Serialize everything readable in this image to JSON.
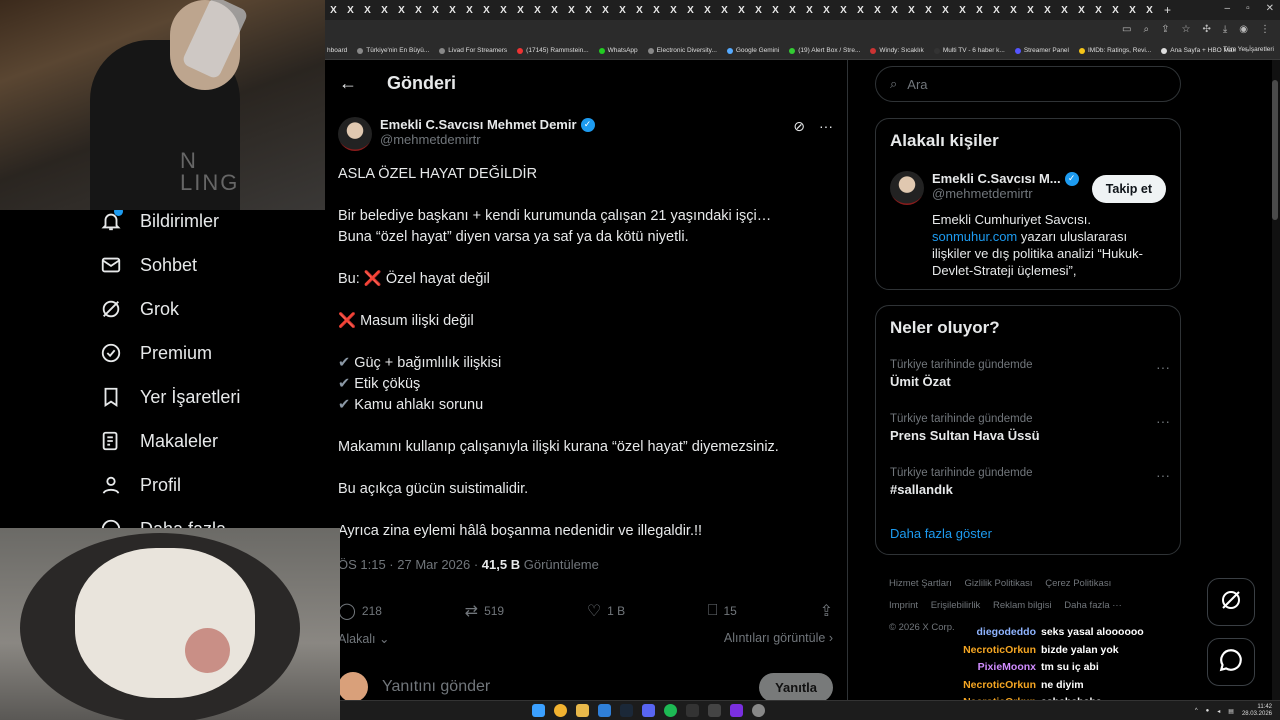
{
  "browser": {
    "tab_glyph": "X",
    "tab_count": 49,
    "new_tab": "+",
    "window_controls": [
      "–",
      "▫",
      "✕"
    ],
    "bookmarks": [
      "hboard",
      "Türkiye'nin En Büyü...",
      "Livad For Streamers",
      "(17145) Rammstein...",
      "WhatsApp",
      "Electronic Diversity...",
      "Google Gemini",
      "(19) Alert Box / Stre...",
      "Windy: Sıcaklık",
      "Multi TV - 6 haber k...",
      "Streamer Panel",
      "IMDb: Ratings, Revi...",
      "Ana Sayfa + HBO Max"
    ],
    "bookmarks_more": "»",
    "all_bookmarks": "Tüm Yer İşaretleri"
  },
  "webcam_top": {
    "shirt_text": "N\nLING"
  },
  "nav": {
    "items": [
      {
        "label": "Bildirimler",
        "icon": "bell-icon"
      },
      {
        "label": "Sohbet",
        "icon": "mail-icon"
      },
      {
        "label": "Grok",
        "icon": "grok-icon"
      },
      {
        "label": "Premium",
        "icon": "verified-badge-icon"
      },
      {
        "label": "Yer İşaretleri",
        "icon": "bookmark-icon"
      },
      {
        "label": "Makaleler",
        "icon": "article-icon"
      },
      {
        "label": "Profil",
        "icon": "person-icon"
      },
      {
        "label": "Daha fazla",
        "icon": "more-circle-icon"
      }
    ]
  },
  "main": {
    "back": "←",
    "title": "Gönderi",
    "author": {
      "name": "Emekli C.Savcısı Mehmet Demir",
      "handle": "@mehmetdemirtr"
    },
    "post": {
      "line1": "ASLA ÖZEL HAYAT DEĞİLDİR",
      "line2": "Bir belediye başkanı + kendi kurumunda çalışan 21 yaşındaki işçi…",
      "line3": "Buna “özel hayat” diyen varsa ya saf ya da kötü niyetli.",
      "line4_prefix": "Bu:",
      "x_mark": "❌",
      "line4": "Özel hayat değil",
      "line5": "Masum ilişki değil",
      "check_mark": "✔",
      "line6": "Güç + bağımlılık ilişkisi",
      "line7": "Etik çöküş",
      "line8": "Kamu ahlakı sorunu",
      "line9": "Makamını kullanıp çalışanıyla ilişki kurana “özel hayat” diyemezsiniz.",
      "line10": "Bu açıkça gücün suistimalidir.",
      "line11": "Ayrıca zina eylemi hâlâ boşanma nedenidir ve illegaldir.!!"
    },
    "meta": {
      "time": "ÖS 1:15 · 27 Mar 2026 · ",
      "views": "41,5 B",
      "views_label": " Görüntüleme"
    },
    "actions": {
      "replies": "218",
      "reposts": "519",
      "likes": "1 B",
      "bookmarks": "15"
    },
    "related": "Alakalı",
    "quotes": "Alıntıları görüntüle",
    "reply_placeholder": "Yanıtını gönder",
    "reply_button": "Yanıtla"
  },
  "sidebar": {
    "search_placeholder": "Ara",
    "related_title": "Alakalı kişiler",
    "related_user": {
      "name": "Emekli C.Savcısı M...",
      "handle": "@mehmetdemirtr",
      "follow": "Takip et",
      "bio_1": "Emekli Cumhuriyet Savcısı.",
      "bio_link": "sonmuhur.com",
      "bio_2": " yazarı uluslararası ilişkiler ve dış politika analizi “Hukuk-Devlet-Strateji üçlemesi”,"
    },
    "trends_title": "Neler oluyor?",
    "trends": [
      {
        "context": "Türkiye tarihinde gündemde",
        "name": "Ümit Özat"
      },
      {
        "context": "Türkiye tarihinde gündemde",
        "name": "Prens Sultan Hava Üssü"
      },
      {
        "context": "Türkiye tarihinde gündemde",
        "name": "#sallandık"
      }
    ],
    "show_more": "Daha fazla göster",
    "footer": [
      "Hizmet Şartları",
      "Gizlilik Politikası",
      "Çerez Politikası",
      "Imprint",
      "Erişilebilirlik",
      "Reklam bilgisi",
      "Daha fazla ···",
      "© 2026 X Corp."
    ]
  },
  "chat": [
    {
      "user": "diegodeddo",
      "color": "#8fb4ff",
      "msg": "seks yasal aloooooo"
    },
    {
      "user": "NecroticOrkun",
      "color": "#f5a623",
      "msg": "bizde yalan yok"
    },
    {
      "user": "PixieMoonx",
      "color": "#d08cff",
      "msg": "tm su iç abi"
    },
    {
      "user": "NecroticOrkun",
      "color": "#f5a623",
      "msg": "ne diyim"
    },
    {
      "user": "NecroticOrkun",
      "color": "#f5a623",
      "msg": "ashahahaha"
    }
  ],
  "taskbar": {
    "time": "11:42",
    "date": "28.03.2026"
  },
  "colors": {
    "accent": "#1d9bf0",
    "x_red": "#f4212e"
  }
}
